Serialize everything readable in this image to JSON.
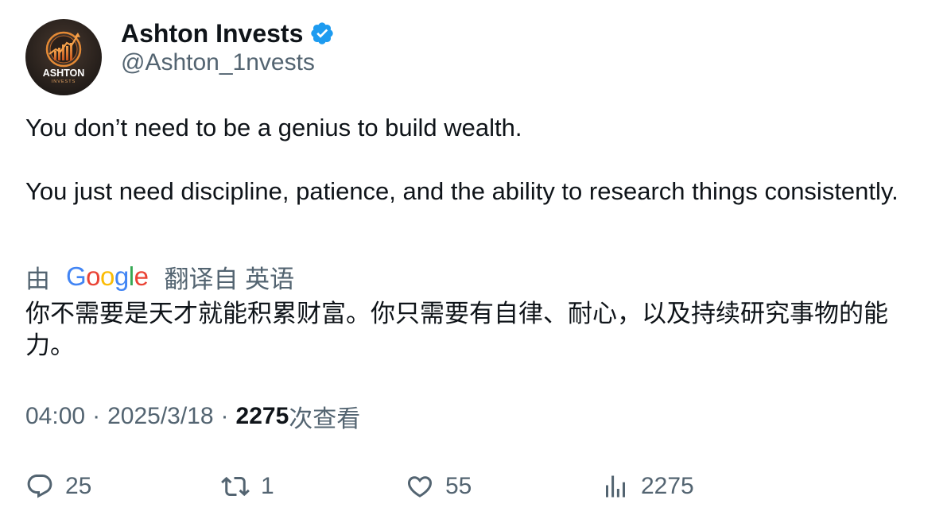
{
  "author": {
    "display_name": "Ashton Invests",
    "handle": "@Ashton_1nvests",
    "avatar": {
      "icon": "ashton-invests-logo",
      "brand_text": "ASHTON",
      "sub_text": "INVESTS",
      "colors": {
        "background": "#2b241f",
        "accent": "#e07a2a"
      }
    },
    "verified_icon": "verified-badge-icon",
    "verified_color": "#1d9bf0"
  },
  "tweet": {
    "paragraphs": [
      "You don’t need to be a genius to build wealth.",
      "You just need discipline, patience, and the ability to research things consistently."
    ]
  },
  "translation": {
    "prefix": "由",
    "provider_letters": [
      "G",
      "o",
      "o",
      "g",
      "l",
      "e"
    ],
    "suffix": "翻译自 英语",
    "text": "你不需要是天才就能积累财富。你只需要有自律、耐心，以及持续研究事物的能力。"
  },
  "meta": {
    "time": "04:00",
    "separator": "·",
    "date": "2025/3/18",
    "views_count": "2275",
    "views_label": "次查看"
  },
  "actions": {
    "reply": {
      "icon": "reply-icon",
      "count": "25"
    },
    "retweet": {
      "icon": "retweet-icon",
      "count": "1"
    },
    "like": {
      "icon": "heart-icon",
      "count": "55"
    },
    "views": {
      "icon": "analytics-icon",
      "count": "2275"
    }
  },
  "colors": {
    "text_primary": "#0f1419",
    "text_secondary": "#536471",
    "google_blue": "#4285f4",
    "google_red": "#ea4335",
    "google_yellow": "#fbbc05",
    "google_green": "#34a853"
  }
}
